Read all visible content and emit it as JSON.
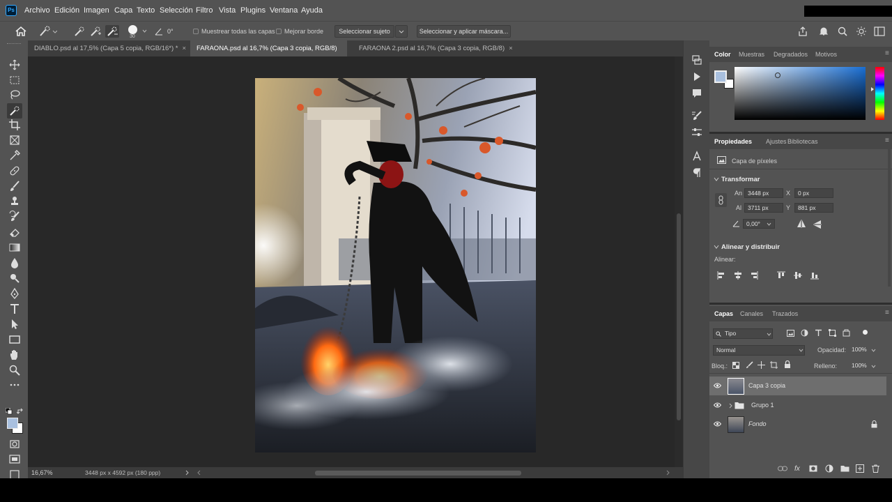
{
  "app": {
    "logo": "Ps"
  },
  "menubar": {
    "items": [
      "Archivo",
      "Edición",
      "Imagen",
      "Capa",
      "Texto",
      "Selección",
      "Filtro",
      "Vista",
      "Plugins",
      "Ventana",
      "Ayuda"
    ]
  },
  "options": {
    "brush_size": "30",
    "angle": "0°",
    "sample_all_layers": "Muestrear todas las capas",
    "enhance_edge": "Mejorar borde",
    "select_subject": "Seleccionar sujeto",
    "select_and_mask": "Seleccionar y aplicar máscara..."
  },
  "tabs": [
    {
      "label": "DIABLO.psd al 17,5% (Capa 5 copia, RGB/16*) *",
      "close": "×"
    },
    {
      "label": "FARAONA.psd al 16,7% (Capa 3 copia, RGB/8) *",
      "close": "×",
      "active": true
    },
    {
      "label": "FARAONA 2.psd al 16,7% (Capa 3 copia, RGB/8)",
      "close": "×"
    }
  ],
  "tools": [
    "home-icon",
    "move-tool-icon",
    "marquee-tool-icon",
    "lasso-tool-icon",
    "quick-selection-tool-icon",
    "crop-tool-icon",
    "frame-tool-icon",
    "eyedropper-tool-icon",
    "healing-brush-tool-icon",
    "brush-tool-icon",
    "clone-stamp-tool-icon",
    "history-brush-tool-icon",
    "eraser-tool-icon",
    "gradient-tool-icon",
    "blur-tool-icon",
    "dodge-tool-icon",
    "pen-tool-icon",
    "type-tool-icon",
    "path-selection-tool-icon",
    "rectangle-tool-icon",
    "hand-tool-icon",
    "zoom-tool-icon",
    "more-tools-icon"
  ],
  "colors": {
    "foreground": "#a9c0df",
    "background": "#ffffff",
    "accent": "#31a8ff",
    "selected_row": "#6e6e6e"
  },
  "status": {
    "zoom": "16,67%",
    "doc_size": "3448 px x 4592 px (180 ppp)"
  },
  "color_panel": {
    "tabs": [
      "Color",
      "Muestras",
      "Degradados",
      "Motivos"
    ]
  },
  "properties_panel": {
    "tabs": [
      "Propiedades",
      "Ajustes",
      "Bibliotecas"
    ],
    "layer_type": "Capa de píxeles",
    "transform_title": "Transformar",
    "width_label": "An",
    "width": "3448 px",
    "height_label": "Al",
    "height": "3711 px",
    "x_label": "X",
    "x": "0 px",
    "y_label": "Y",
    "y": "881 px",
    "angle": "0,00°",
    "align_title": "Alinear y distribuir",
    "align_label": "Alinear:"
  },
  "layers_panel": {
    "tabs": [
      "Capas",
      "Canales",
      "Trazados"
    ],
    "filter": "Tipo",
    "blend_mode": "Normal",
    "opacity_label": "Opacidad:",
    "opacity": "100%",
    "lock_label": "Bloq.:",
    "fill_label": "Relleno:",
    "fill": "100%",
    "layers": [
      {
        "name": "Capa 3 copia",
        "selected": true
      },
      {
        "name": "Grupo 1",
        "group": true
      },
      {
        "name": "Fondo",
        "locked": true
      }
    ]
  }
}
